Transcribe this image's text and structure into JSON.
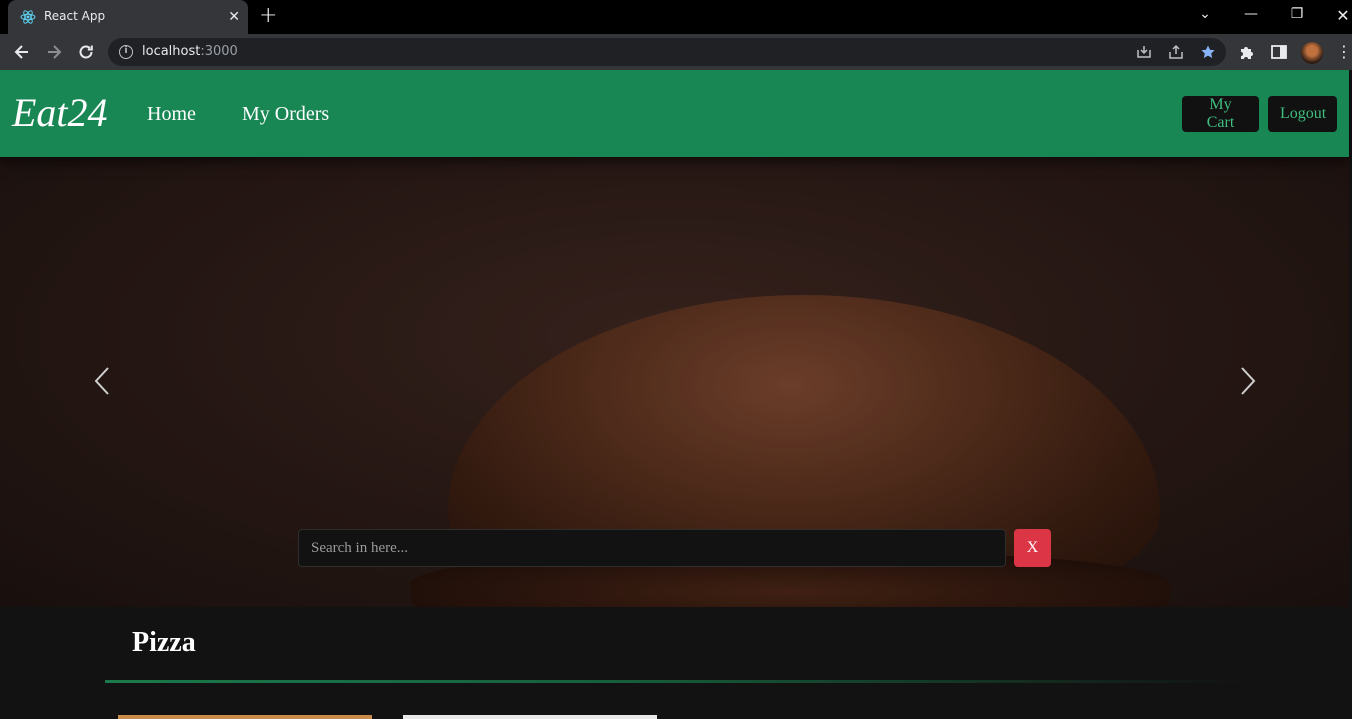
{
  "browser": {
    "tab_title": "React App",
    "tab_icon": "react-logo-icon",
    "url_host": "localhost",
    "url_port": ":3000"
  },
  "navbar": {
    "brand": "Eat24",
    "links": [
      "Home",
      "My Orders"
    ],
    "buttons": {
      "cart": "My Cart",
      "logout": "Logout"
    },
    "bg_color": "#198754"
  },
  "carousel": {
    "search_placeholder": "Search in here...",
    "clear_label": "X",
    "clear_color": "#dc3545",
    "prev_icon": "chevron-left-icon",
    "next_icon": "chevron-right-icon"
  },
  "category": {
    "title": "Pizza"
  }
}
